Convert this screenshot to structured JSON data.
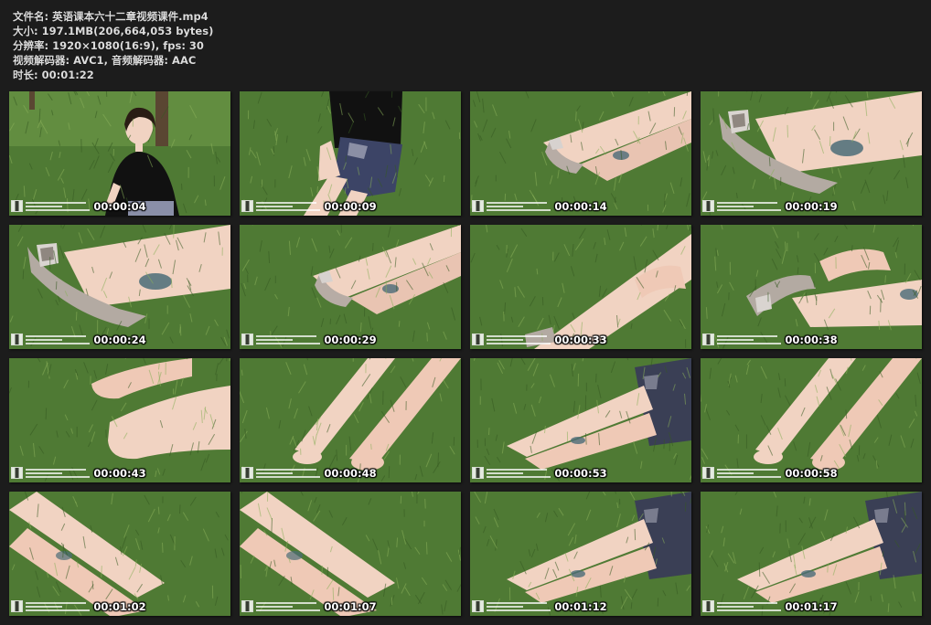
{
  "info": {
    "filename": "文件名: 英语课本六十二章视频课件.mp4",
    "size": "大小: 197.1MB(206,664,053 bytes)",
    "resolution": "分辨率: 1920×1080(16:9), fps: 30",
    "codecs": "视频解码器: AVC1, 音频解码器: AAC",
    "duration": "时长: 00:01:22"
  },
  "thumbnails": [
    {
      "time": "00:00:04",
      "scene": "person"
    },
    {
      "time": "00:00:09",
      "scene": "seated"
    },
    {
      "time": "00:00:14",
      "scene": "legs-shoes"
    },
    {
      "time": "00:00:19",
      "scene": "shoe-close"
    },
    {
      "time": "00:00:24",
      "scene": "shoe-close"
    },
    {
      "time": "00:00:29",
      "scene": "legs-shoes"
    },
    {
      "time": "00:00:33",
      "scene": "hands-legs"
    },
    {
      "time": "00:00:38",
      "scene": "remove-shoe"
    },
    {
      "time": "00:00:43",
      "scene": "feet-close"
    },
    {
      "time": "00:00:48",
      "scene": "feet-up"
    },
    {
      "time": "00:00:53",
      "scene": "legs-skirt"
    },
    {
      "time": "00:00:58",
      "scene": "feet-up"
    },
    {
      "time": "00:01:02",
      "scene": "legs-diag"
    },
    {
      "time": "00:01:07",
      "scene": "legs-diag"
    },
    {
      "time": "00:01:12",
      "scene": "legs-skirt"
    },
    {
      "time": "00:01:17",
      "scene": "legs-skirt"
    }
  ],
  "colors": {
    "background": "#1c1c1c",
    "grass": "#4f7a34",
    "grass_light": "#8ab05a",
    "skin": "#f1d3c2",
    "text": "#dcdcdc"
  }
}
